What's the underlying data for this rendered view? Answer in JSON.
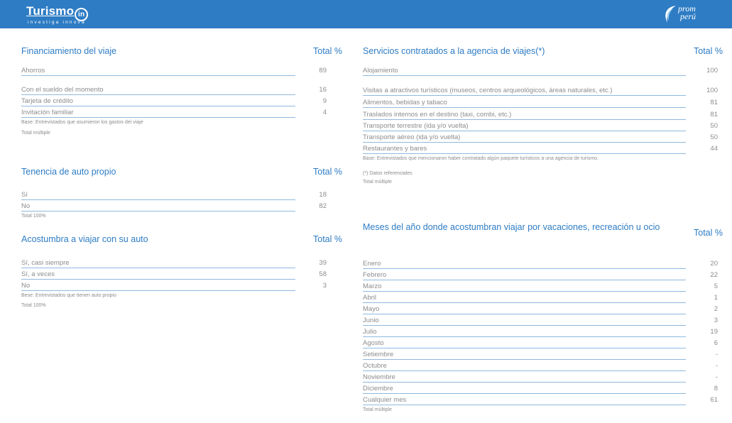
{
  "header": {
    "logo_left_word": "Turismo",
    "logo_left_mark": "in",
    "logo_left_tagline": "investiga innova",
    "logo_right_text_1": "prom",
    "logo_right_text_2": "perú",
    "brand_color": "#2e7cc4"
  },
  "financiamiento": {
    "title": "Financiamiento del viaje",
    "total_label": "Total %",
    "rows": [
      {
        "label": "Ahorros",
        "value": "89"
      },
      {
        "label": "Con el sueldo del momento",
        "value": "16"
      },
      {
        "label": "Tarjeta de crédito",
        "value": "9"
      },
      {
        "label": "Invitación familiar",
        "value": "4"
      }
    ],
    "note_base": "Base: Entrevistados que asumieron los gastos del viaje",
    "note_total": "Total múltiple"
  },
  "tenencia": {
    "title": "Tenencia de auto propio",
    "total_label": "Total %",
    "rows": [
      {
        "label": "Sí",
        "value": "18"
      },
      {
        "label": "No",
        "value": "82"
      }
    ],
    "note_total": "Total 100%"
  },
  "acostumbra": {
    "title": "Acostumbra a viajar con su auto",
    "total_label": "Total %",
    "rows": [
      {
        "label": "Sí, casi siempre",
        "value": "39"
      },
      {
        "label": "Sí, a veces",
        "value": "58"
      },
      {
        "label": "No",
        "value": "3"
      }
    ],
    "note_base": "Bese: Entrevistados que tienen auto propio",
    "note_total": "Total 100%"
  },
  "servicios": {
    "title": "Servicios contratados a la agencia de viajes(*)",
    "total_label": "Total %",
    "rows": [
      {
        "label": "Alojamiento",
        "value": "100"
      },
      {
        "label": "Visitas a atractivos turísticos (museos, centros arqueológicos, áreas naturales, etc.)",
        "value": "100"
      },
      {
        "label": "Alimentos, bebidas y tabaco",
        "value": "81"
      },
      {
        "label": "Traslados internos en el destino (taxi, combi, etc.)",
        "value": "81"
      },
      {
        "label": "Transporte terrestre (ida y/o vuelta)",
        "value": "50"
      },
      {
        "label": "Transporte aéreo (ida y/o vuelta)",
        "value": "50"
      },
      {
        "label": "Restaurantes y bares",
        "value": "44"
      }
    ],
    "note_base": "Base: Entrevistados que mencionaron haber contratado algún paquete turísticos a una agencia de turismo.",
    "note_ref": "(*) Datos referenciales",
    "note_total": "Total múltiple"
  },
  "meses": {
    "title": "Meses del año donde acostumbran viajar por vacaciones, recreación u ocio",
    "total_label": "Total %",
    "rows": [
      {
        "label": "Enero",
        "value": "20"
      },
      {
        "label": "Febrero",
        "value": "22"
      },
      {
        "label": "Marzo",
        "value": "5"
      },
      {
        "label": "Abril",
        "value": "1"
      },
      {
        "label": "Mayo",
        "value": "2"
      },
      {
        "label": "Junio",
        "value": "3"
      },
      {
        "label": "Julio",
        "value": "19"
      },
      {
        "label": "Agosto",
        "value": "6"
      },
      {
        "label": "Setiembre",
        "value": "-"
      },
      {
        "label": "Octubre",
        "value": "-"
      },
      {
        "label": "Noviembre",
        "value": "-"
      },
      {
        "label": "Diciembre",
        "value": "8"
      },
      {
        "label": "Cualquier mes",
        "value": "61"
      }
    ],
    "note_total": "Total múltiple"
  }
}
